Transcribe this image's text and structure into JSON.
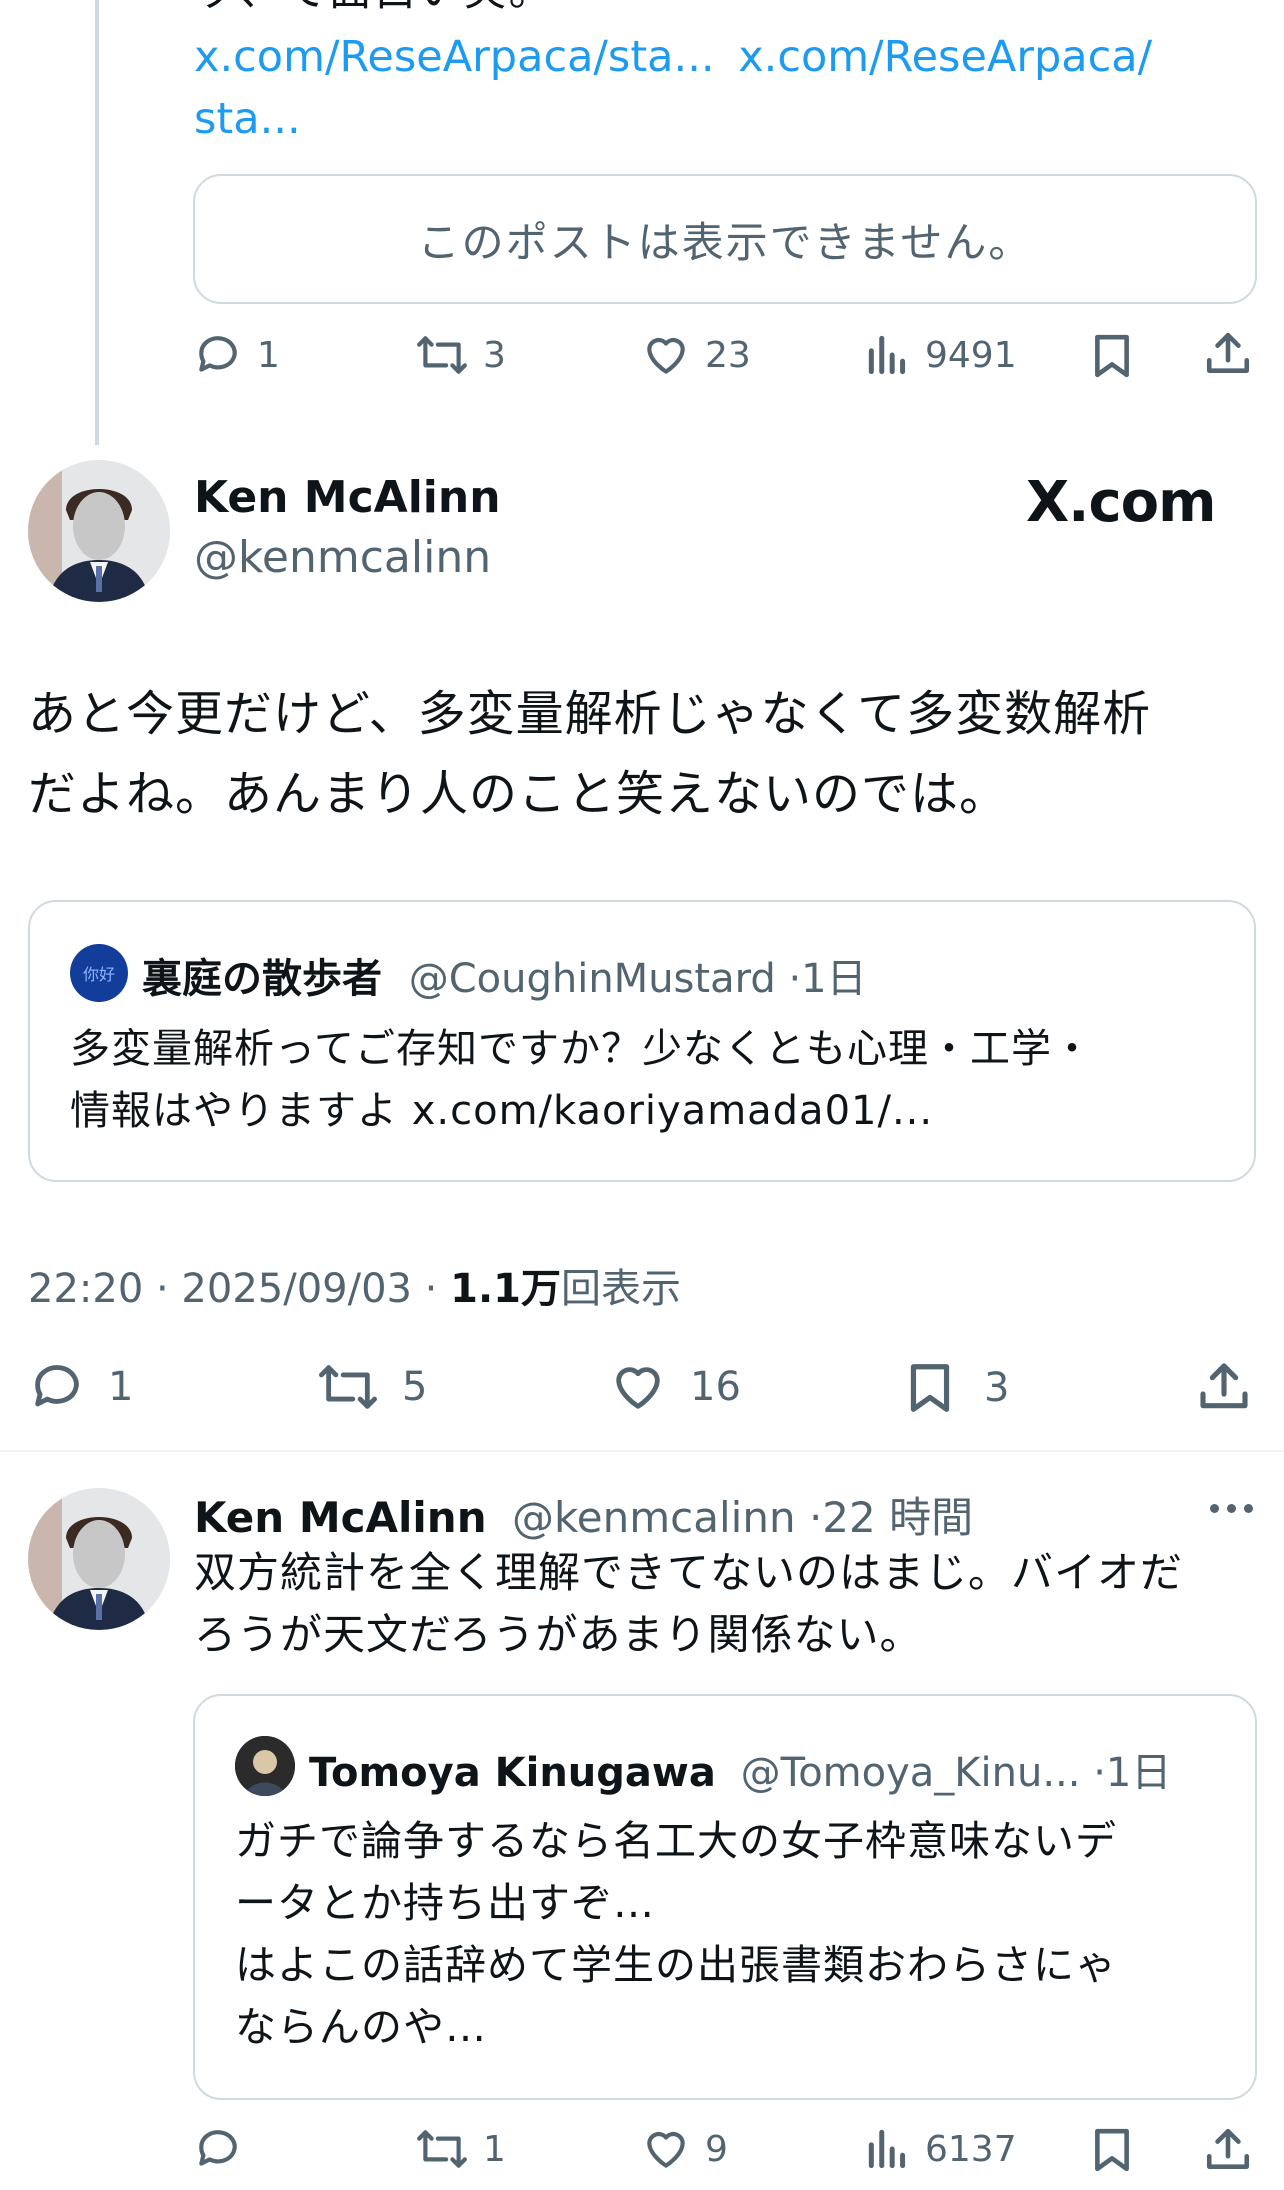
{
  "top_post": {
    "text_partial": "ッ、て面白い笑。",
    "link1": "x.com/ReseArpaca/sta...",
    "link2": "x.com/ReseArpaca/",
    "link3": "sta...",
    "unavailable": "このポストは表示できません。",
    "actions": {
      "reply": "1",
      "repost": "3",
      "like": "23",
      "views": "9491"
    }
  },
  "main_post": {
    "name": "Ken McAlinn",
    "handle": "@kenmcalinn",
    "source": "X.com",
    "text_line1": "あと今更だけど、多変量解析じゃなくて多変数解析",
    "text_line2": "だよね。あんまり人のこと笑えないのでは。",
    "quote": {
      "avatar_text": "你好",
      "name": "裏庭の散歩者",
      "handle": "@CoughinMustard",
      "time": "·1日",
      "line1": "多変量解析ってご存知ですか？少なくとも心理・工学・",
      "line2": "情報はやりますよ x.com/kaoriyamada01/..."
    },
    "meta": {
      "time": "22:20 · 2025/09/03 · ",
      "views_count": "1.1万",
      "views_label": "回表示"
    },
    "actions": {
      "reply": "1",
      "repost": "5",
      "like": "16",
      "bookmark": "3"
    }
  },
  "reply_post": {
    "name": "Ken McAlinn",
    "handle": "@kenmcalinn",
    "time": "·22 時間",
    "line1": "双方統計を全く理解できてないのはまじ。バイオだ",
    "line2": "ろうが天文だろうがあまり関係ない。",
    "quote": {
      "name": "Tomoya Kinugawa",
      "handle": "@Tomoya_Kinu...",
      "time": "·1日",
      "line1": "ガチで論争するなら名工大の女子枠意味ないデ",
      "line2": "ータとか持ち出すぞ…",
      "line3": "はよこの話辞めて学生の出張書類おわらさにゃ",
      "line4": "ならんのや…"
    },
    "actions": {
      "reply": "",
      "repost": "1",
      "like": "9",
      "views": "6137"
    }
  },
  "colors": {
    "link": "#1d9bf0",
    "secondary": "#536471",
    "border": "#cfd9de",
    "text": "#0f1419"
  }
}
